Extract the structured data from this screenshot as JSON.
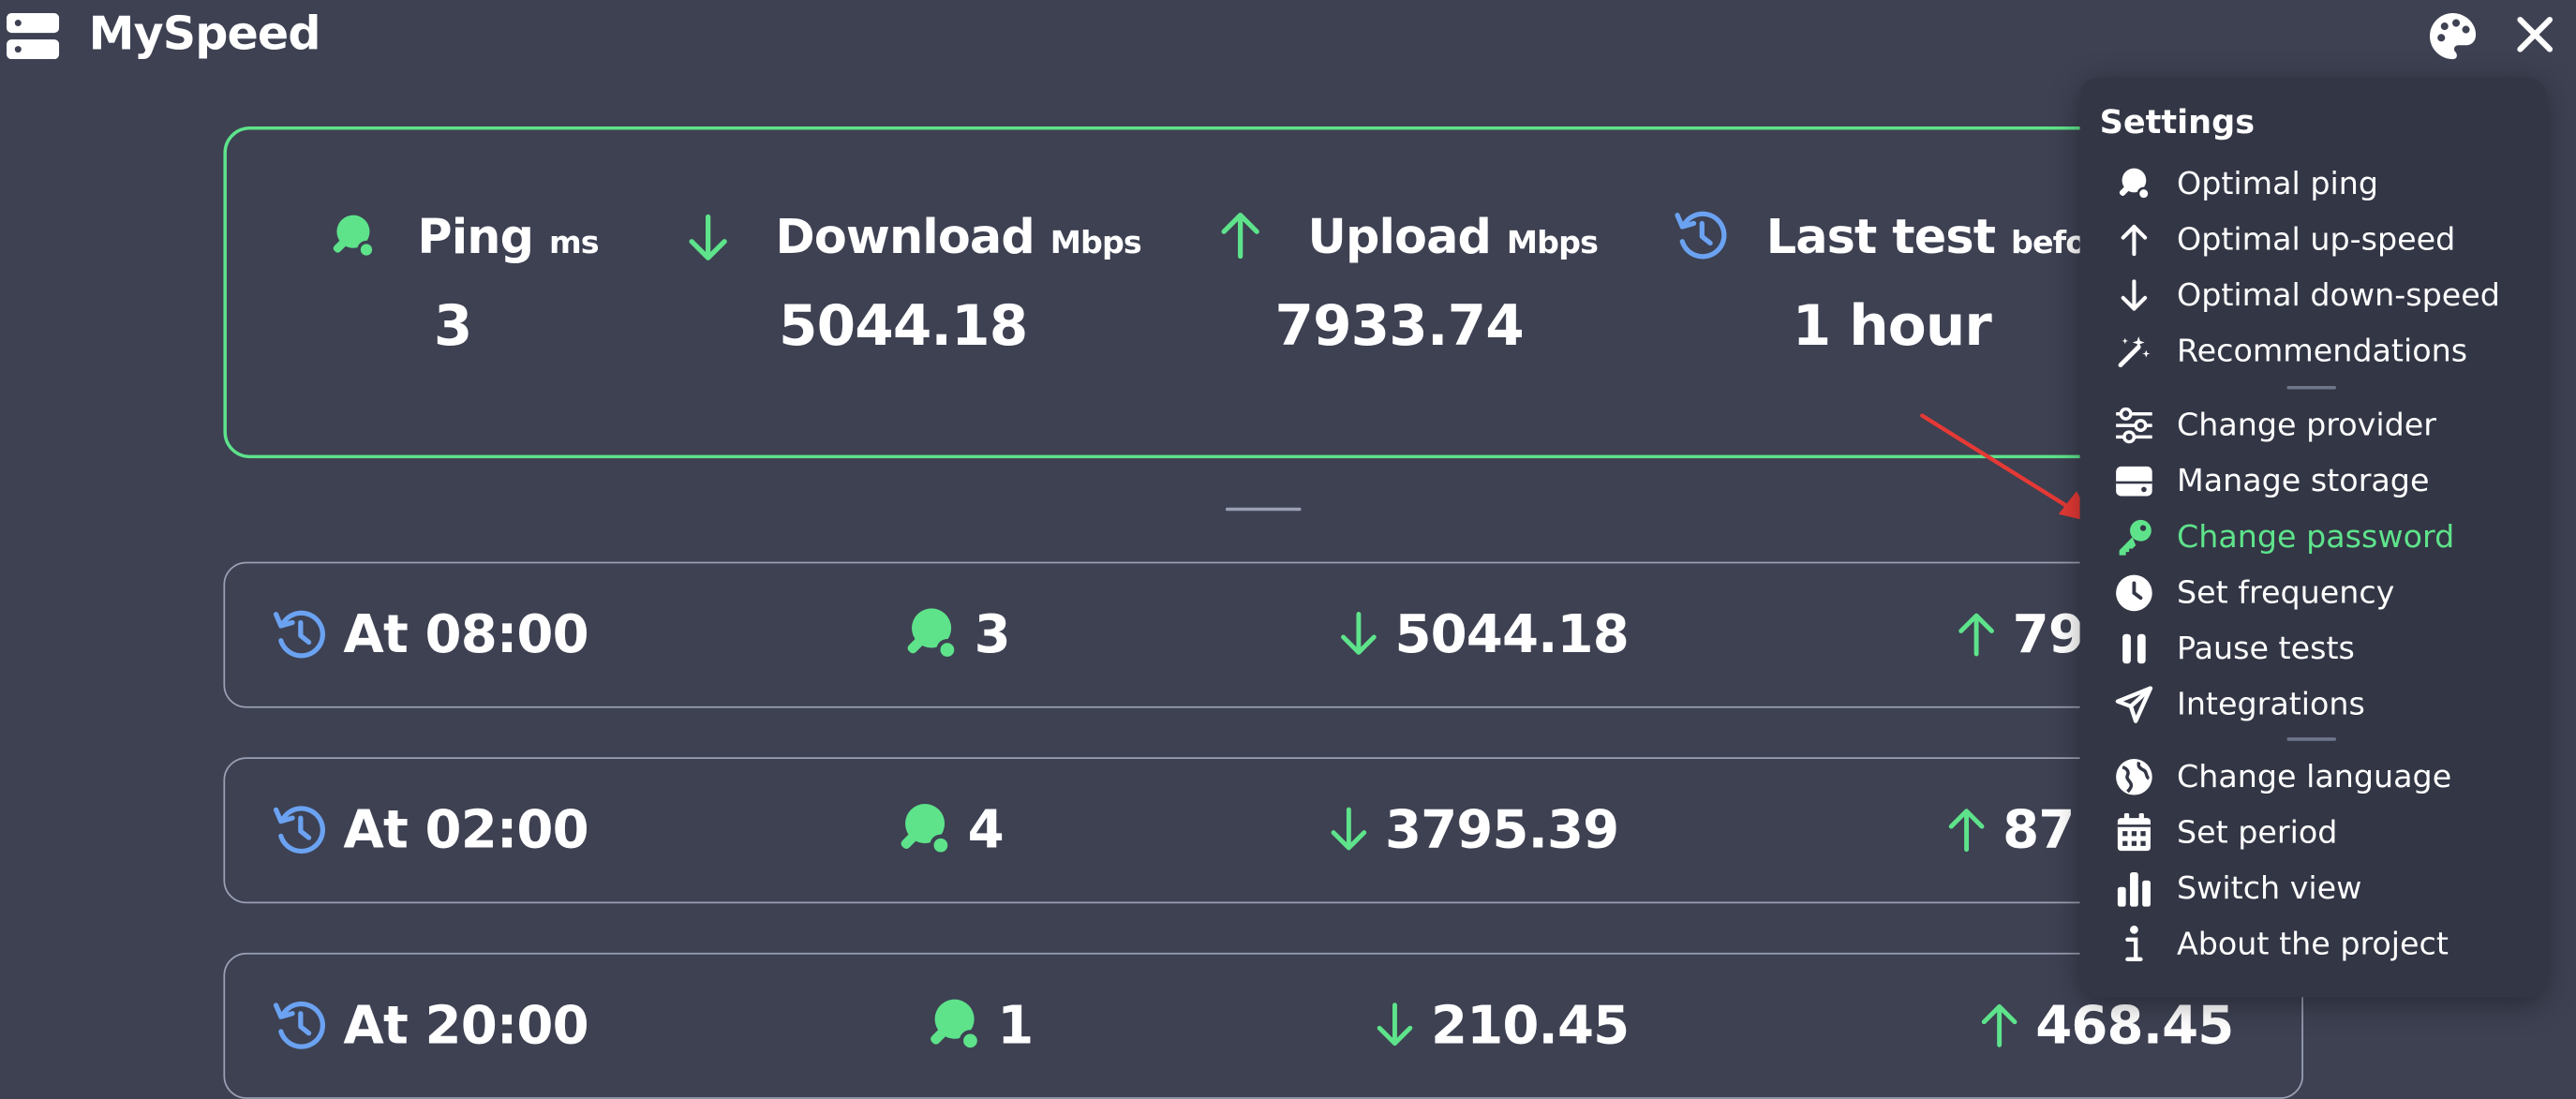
{
  "app": {
    "title": "MySpeed"
  },
  "colors": {
    "background": "#3d4152",
    "accent": "#5ee38b",
    "history_icon": "#6ba2f1",
    "menu_bg": "#333645"
  },
  "stats": {
    "ping": {
      "label": "Ping",
      "unit": "ms",
      "value": "3",
      "icon": "ping-pong-icon"
    },
    "download": {
      "label": "Download",
      "unit": "Mbps",
      "value": "5044.18",
      "icon": "arrow-down-icon"
    },
    "upload": {
      "label": "Upload",
      "unit": "Mbps",
      "value": "7933.74",
      "icon": "arrow-up-icon"
    },
    "last_test": {
      "label": "Last test",
      "unit": "before",
      "value": "1 hour",
      "icon": "history-icon"
    }
  },
  "tests": [
    {
      "time": "At 08:00",
      "ping": "3",
      "download": "5044.18",
      "upload": "79"
    },
    {
      "time": "At 02:00",
      "ping": "4",
      "download": "3795.39",
      "upload": "87"
    },
    {
      "time": "At 20:00",
      "ping": "1",
      "download": "210.45",
      "upload": "468.45"
    }
  ],
  "settings_menu": {
    "title": "Settings",
    "items": [
      {
        "label": "Optimal ping",
        "icon": "ping-pong-icon"
      },
      {
        "label": "Optimal up-speed",
        "icon": "arrow-up-icon"
      },
      {
        "label": "Optimal down-speed",
        "icon": "arrow-down-icon"
      },
      {
        "label": "Recommendations",
        "icon": "magic-wand-icon"
      },
      {
        "label": "Change provider",
        "icon": "sliders-icon"
      },
      {
        "label": "Manage storage",
        "icon": "hard-drive-icon"
      },
      {
        "label": "Change password",
        "icon": "key-icon",
        "highlighted": true
      },
      {
        "label": "Set frequency",
        "icon": "clock-icon"
      },
      {
        "label": "Pause tests",
        "icon": "pause-icon"
      },
      {
        "label": "Integrations",
        "icon": "send-icon"
      },
      {
        "label": "Change language",
        "icon": "globe-icon"
      },
      {
        "label": "Set period",
        "icon": "calendar-icon"
      },
      {
        "label": "Switch view",
        "icon": "bar-chart-icon"
      },
      {
        "label": "About the project",
        "icon": "info-icon"
      }
    ]
  }
}
